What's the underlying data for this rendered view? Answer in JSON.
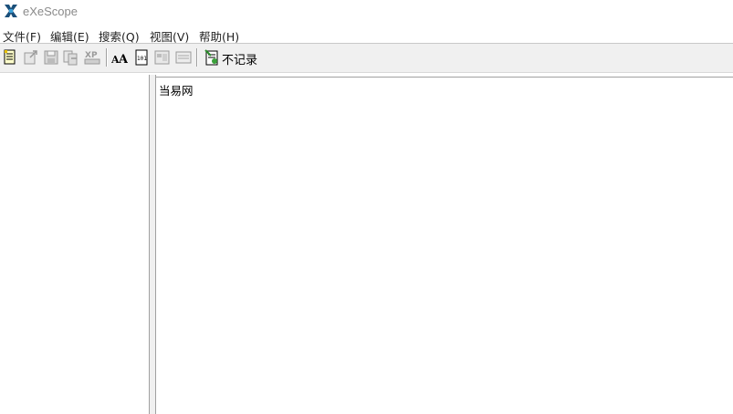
{
  "window": {
    "title": "eXeScope",
    "icon": "exescope-app-icon"
  },
  "menubar": {
    "items": [
      {
        "label": "文件(F)"
      },
      {
        "label": "编辑(E)"
      },
      {
        "label": "搜索(Q)"
      },
      {
        "label": "视图(V)"
      },
      {
        "label": "帮助(H)"
      }
    ]
  },
  "toolbar": {
    "buttons": [
      {
        "icon": "open-file-icon",
        "enabled": true
      },
      {
        "icon": "export-icon",
        "enabled": false
      },
      {
        "icon": "save-icon",
        "enabled": false
      },
      {
        "icon": "import-icon",
        "enabled": false
      },
      {
        "icon": "xp-manifest-icon",
        "enabled": false
      },
      {
        "icon": "font-icon",
        "enabled": true
      },
      {
        "icon": "hex-view-icon",
        "enabled": true
      },
      {
        "icon": "dialog-editor-icon",
        "enabled": false
      },
      {
        "icon": "resource-view-icon",
        "enabled": false
      },
      {
        "icon": "record-icon",
        "enabled": true
      }
    ],
    "record_label": "不记录"
  },
  "right_pane": {
    "text": "当易网"
  }
}
